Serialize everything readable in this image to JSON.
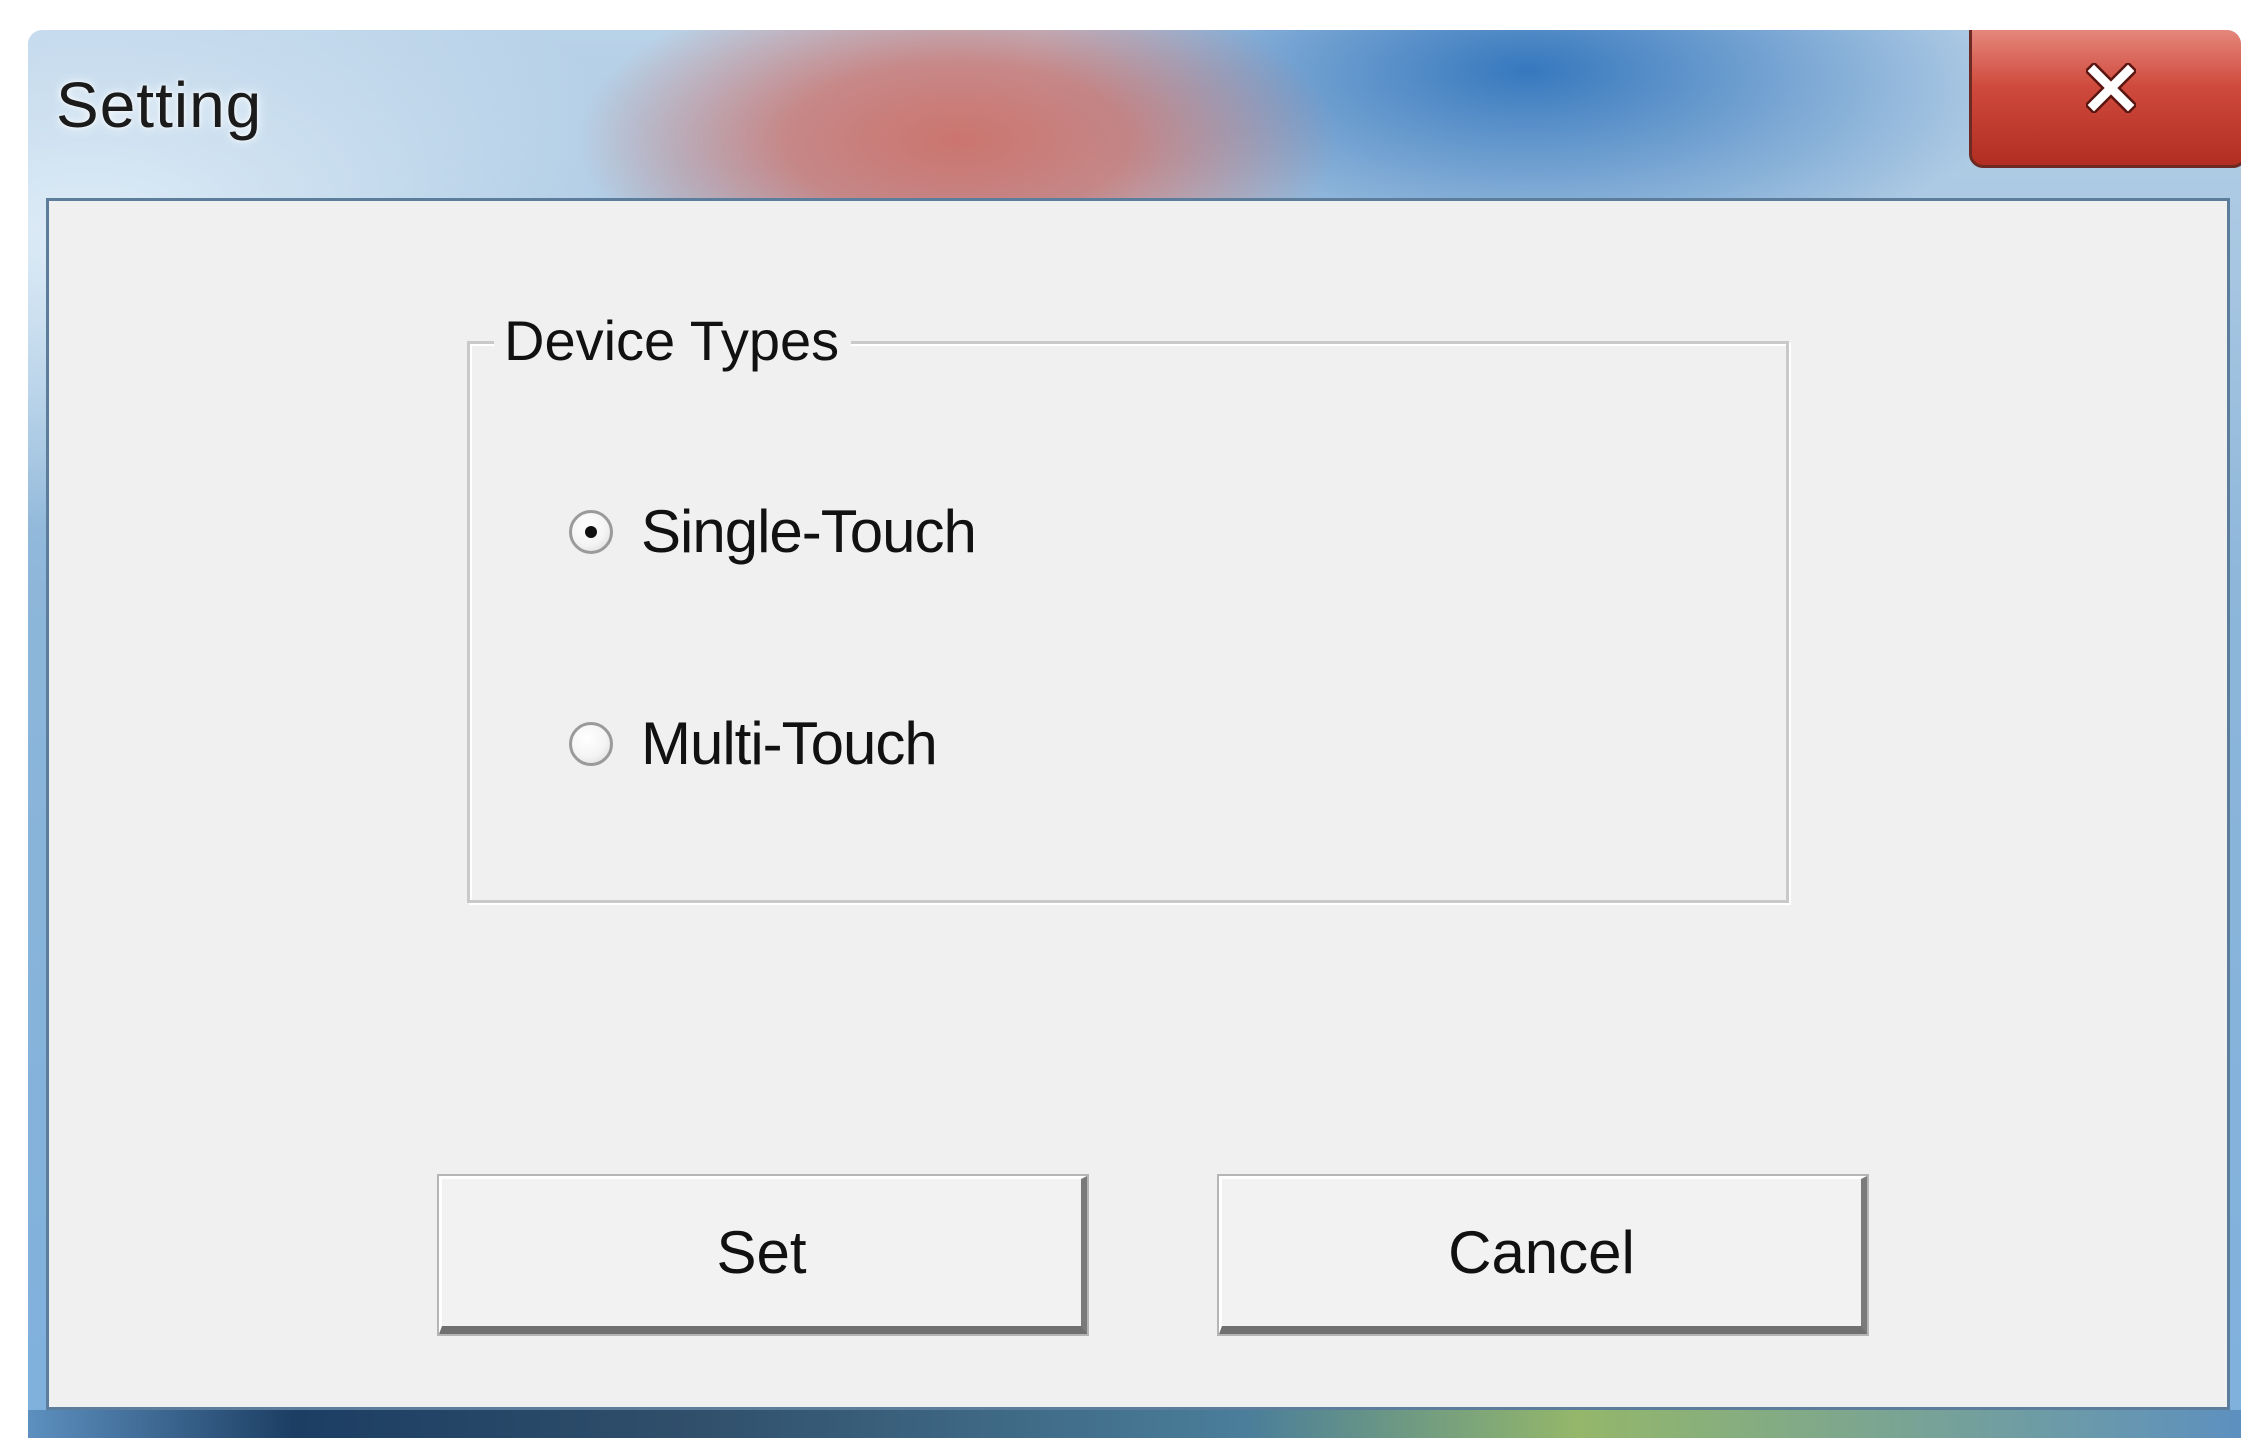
{
  "window": {
    "title": "Setting",
    "close_icon": "close-x-icon",
    "close_color": "#c9392e"
  },
  "group": {
    "title": "Device Types",
    "options": [
      {
        "label": "Single-Touch",
        "selected": true
      },
      {
        "label": "Multi-Touch",
        "selected": false
      }
    ]
  },
  "buttons": {
    "set_label": "Set",
    "cancel_label": "Cancel"
  }
}
